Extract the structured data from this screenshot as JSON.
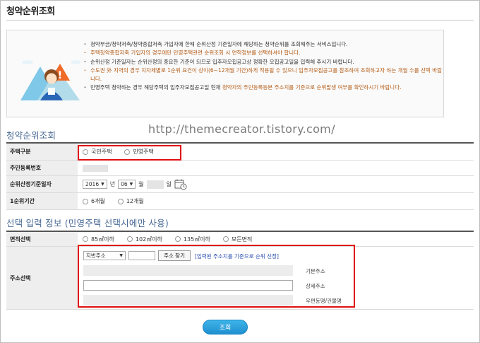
{
  "page": {
    "title": "청약순위조회",
    "watermark": "http://themecreator.tistory.com/"
  },
  "notice": {
    "items": [
      {
        "text": "청약부금/청약저축/청약종합저축 가입자에 한해 순위산정 기준일자에 해당하는 청약순위를 조회해주는 서비스입니다.",
        "highlight": false
      },
      {
        "text": "주택청약종합저축 가입자의 경우에만 민영주택관련 순위조회 시 면적정보를 선택하셔야 합니다.",
        "highlight": true
      },
      {
        "text": "순위산정 기준일자는 순위산정의 중요한 기준이 되므로 입주자모집공고상 정확한 모집공고일을 입력해 주시기 바랍니다.",
        "highlight": false
      },
      {
        "text": "수도권 外 지역의 경우 지자체별로 1순위 요건이 상이(6~12개월 기간)하게 적용될 수 있으니 입주자모집공고를 참조하여 조회하고자 하는 개월 수를 선택 바랍니다.",
        "highlight": true
      },
      {
        "pre": "민영주택 청약하는 경우 해당주택의 입주자모집공고일 현재 ",
        "mid": "청약자의 주민등록등본 주소지를 기준으로 순위발생 여부를 확인하시기 바랍니다.",
        "highlight": false
      }
    ]
  },
  "inquiry": {
    "section_title": "청약순위조회",
    "housing_type": {
      "label": "주택구분",
      "options": [
        "국민주택",
        "민영주택"
      ]
    },
    "resident_number": {
      "label": "주민등록번호"
    },
    "base_date": {
      "label": "순위산정기준일자",
      "year": "2016",
      "year_unit": "년",
      "month": "06",
      "month_unit": "월",
      "day_unit": "일"
    },
    "first_rank_period": {
      "label": "1순위기간",
      "options": [
        "6개월",
        "12개월"
      ]
    }
  },
  "optional": {
    "section_title": "선택 입력 정보 (민영주택 선택시에만 사용)",
    "area": {
      "label": "면적선택",
      "options": [
        "85㎡이하",
        "102㎡이하",
        "135㎡이하",
        "모든면적"
      ]
    },
    "address": {
      "label": "주소선택",
      "address_type": "지번주소",
      "find_button": "주소 찾기",
      "link_text": "[입력된 주소지를 기준으로 순위 선정]",
      "fields": [
        "기본주소",
        "상세주소",
        "우편동명/건물명"
      ]
    }
  },
  "submit": {
    "label": "조회"
  },
  "colors": {
    "accent": "#4a6b96",
    "highlight": "#b45a14",
    "annotation": "#e01010",
    "button": "#1f8fd0"
  }
}
